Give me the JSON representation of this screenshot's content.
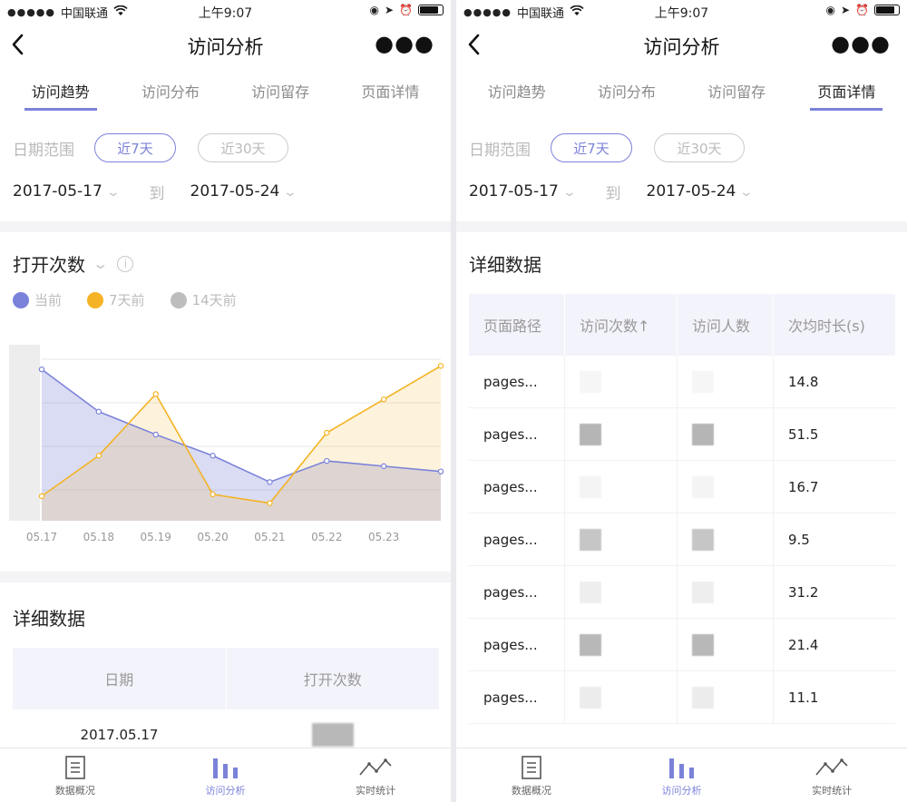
{
  "status": {
    "carrier": "中国联通",
    "time": "上午9:07"
  },
  "nav": {
    "title": "访问分析"
  },
  "tabs": [
    "访问趋势",
    "访问分布",
    "访问留存",
    "页面详情"
  ],
  "range": {
    "label": "日期范围",
    "option_7": "近7天",
    "option_30": "近30天",
    "start": "2017-05-17",
    "to": "到",
    "end": "2017-05-24"
  },
  "metric": {
    "title": "打开次数"
  },
  "chart_data": {
    "type": "line",
    "title": "打开次数",
    "categories": [
      "05.17",
      "05.18",
      "05.19",
      "05.20",
      "05.21",
      "05.22",
      "05.23",
      ""
    ],
    "series": [
      {
        "name": "当前",
        "color": "#7b82d9",
        "values": [
          0.86,
          0.62,
          0.49,
          0.37,
          0.22,
          0.34,
          0.31,
          0.28
        ]
      },
      {
        "name": "7天前",
        "color": "#f4b324",
        "values": [
          0.14,
          0.37,
          0.72,
          0.15,
          0.1,
          0.5,
          0.69,
          0.88
        ]
      },
      {
        "name": "14天前",
        "color": "#bdbdbd",
        "values": []
      }
    ],
    "xlabel": "",
    "ylabel": "",
    "ylim": [
      0,
      1
    ],
    "grid": true,
    "legend": "top-left"
  },
  "detail": {
    "title": "详细数据",
    "left_headers": [
      "日期",
      "打开次数"
    ],
    "left_rows": [
      {
        "date": "2017.05.17"
      }
    ],
    "right_headers": [
      "页面路径",
      "访问次数↑",
      "访问人数",
      "次均时长(s)"
    ],
    "right_rows": [
      {
        "path": "pages...",
        "avg": "14.8"
      },
      {
        "path": "pages...",
        "avg": "51.5"
      },
      {
        "path": "pages...",
        "avg": "16.7"
      },
      {
        "path": "pages...",
        "avg": "9.5"
      },
      {
        "path": "pages...",
        "avg": "31.2"
      },
      {
        "path": "pages...",
        "avg": "21.4"
      },
      {
        "path": "pages...",
        "avg": "11.1"
      }
    ]
  },
  "tabbar": [
    "数据概况",
    "访问分析",
    "实时统计"
  ],
  "colors": {
    "accent": "#7b82d9",
    "orange": "#f4b324",
    "gray": "#bdbdbd"
  }
}
